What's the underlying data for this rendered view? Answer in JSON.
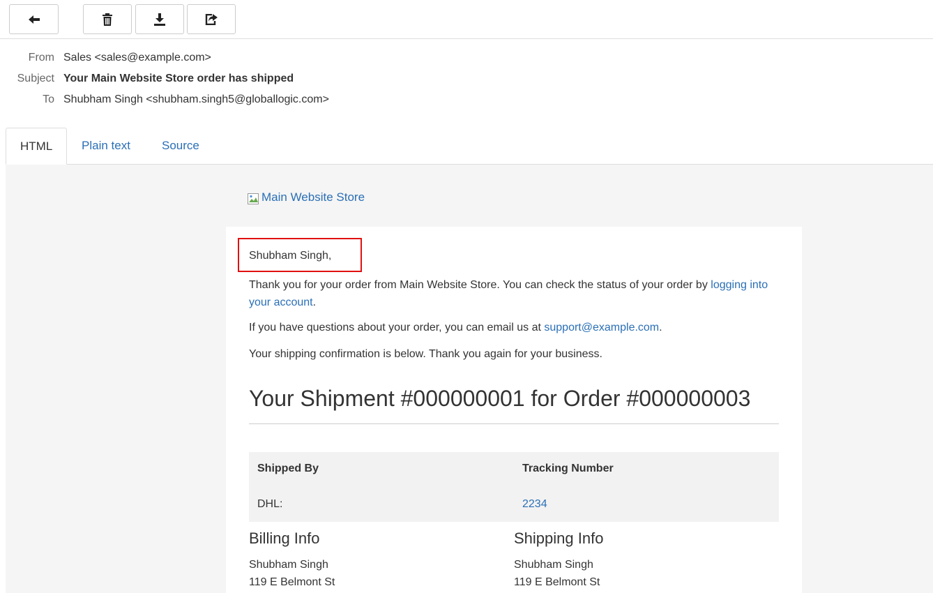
{
  "toolbar": {
    "buttons": [
      {
        "name": "back-button",
        "icon": "arrow-left-icon"
      },
      {
        "name": "delete-button",
        "icon": "trash-icon"
      },
      {
        "name": "download-button",
        "icon": "download-icon"
      },
      {
        "name": "share-button",
        "icon": "share-icon"
      }
    ]
  },
  "headers": {
    "from_label": "From",
    "from_value": "Sales <sales@example.com>",
    "subject_label": "Subject",
    "subject_value": "Your Main Website Store order has shipped",
    "to_label": "To",
    "to_value": "Shubham Singh <shubham.singh5@globallogic.com>"
  },
  "tabs": [
    {
      "label": "HTML",
      "active": true
    },
    {
      "label": "Plain text",
      "active": false
    },
    {
      "label": "Source",
      "active": false
    }
  ],
  "email": {
    "logo_alt": "Main Website Store",
    "greeting": "Shubham Singh,",
    "thanks_text": "Thank you for your order from Main Website Store. You can check the status of your order by",
    "account_link": "logging into your account",
    "period": ".",
    "questions_text": "If you have questions about your order, you can email us at",
    "support_email": "support@example.com",
    "confirmation_text": "Your shipping confirmation is below. Thank you again for your business.",
    "shipment_title": "Your Shipment #000000001 for Order #000000003",
    "tracking": {
      "col1_header": "Shipped By",
      "col2_header": "Tracking Number",
      "carrier": "DHL:",
      "number": "2234"
    },
    "billing": {
      "heading": "Billing Info",
      "name": "Shubham Singh",
      "street": "119 E Belmont St"
    },
    "shipping": {
      "heading": "Shipping Info",
      "name": "Shubham Singh",
      "street": "119 E Belmont St"
    }
  },
  "colors": {
    "link": "#2a6fb6",
    "highlight_box": "#e01010",
    "mail_background": "#f5f5f5"
  }
}
